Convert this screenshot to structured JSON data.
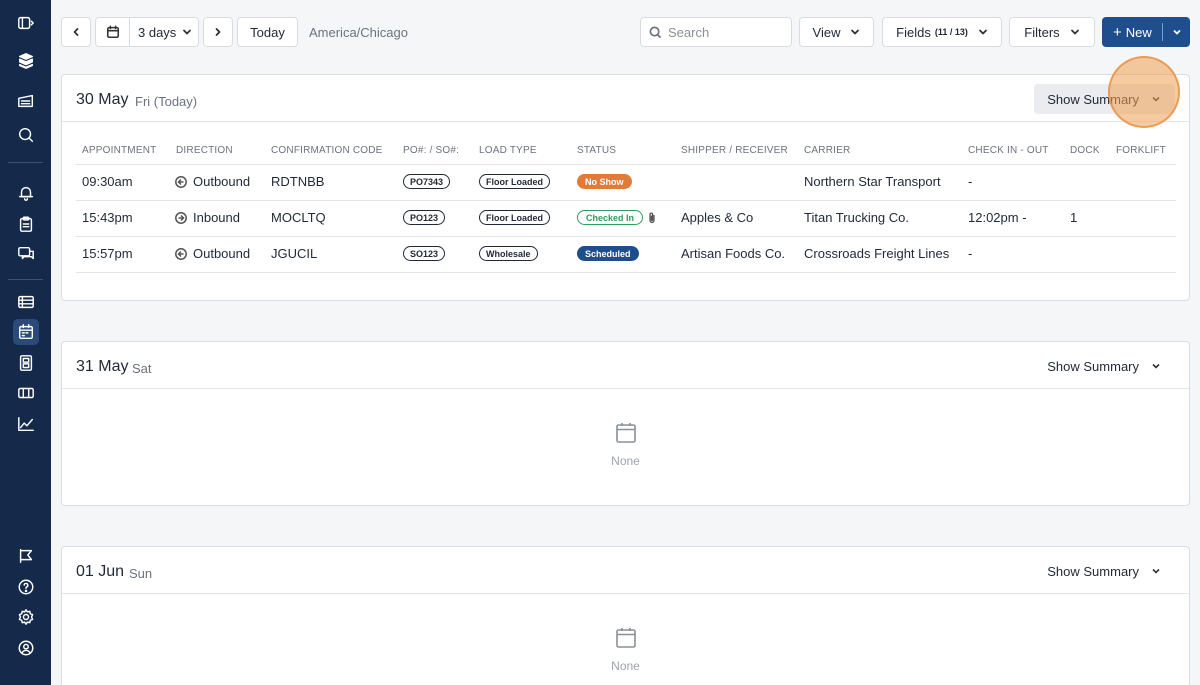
{
  "toolbar": {
    "range_label": "3 days",
    "today_label": "Today",
    "timezone": "America/Chicago",
    "search_placeholder": "Search",
    "view_label": "View",
    "fields_label": "Fields",
    "fields_count": "(11 / 13)",
    "filters_label": "Filters",
    "new_label": "New"
  },
  "days": [
    {
      "date": "30 May",
      "weekday": "Fri (Today)",
      "summary_label": "Show Summary"
    },
    {
      "date": "31 May",
      "weekday": "Sat",
      "summary_label": "Show Summary",
      "empty_label": "None"
    },
    {
      "date": "01 Jun",
      "weekday": "Sun",
      "summary_label": "Show Summary",
      "empty_label": "None"
    }
  ],
  "table": {
    "headers": [
      "APPOINTMENT",
      "DIRECTION",
      "CONFIRMATION CODE",
      "PO#: / SO#:",
      "LOAD TYPE",
      "STATUS",
      "SHIPPER / RECEIVER",
      "CARRIER",
      "CHECK IN - OUT",
      "DOCK",
      "FORKLIFT"
    ],
    "rows": [
      {
        "time": "09:30am",
        "direction": "Outbound",
        "code": "RDTNBB",
        "po": "PO7343",
        "load": "Floor Loaded",
        "status": "No Show",
        "shipper": "",
        "carrier": "Northern Star Transport",
        "check": "-",
        "dock": "",
        "forklift": ""
      },
      {
        "time": "15:43pm",
        "direction": "Inbound",
        "code": "MOCLTQ",
        "po": "PO123",
        "load": "Floor Loaded",
        "status": "Checked In",
        "shipper": "Apples & Co",
        "carrier": "Titan Trucking Co.",
        "check": "12:02pm -",
        "dock": "1",
        "forklift": ""
      },
      {
        "time": "15:57pm",
        "direction": "Outbound",
        "code": "JGUCIL",
        "po": "SO123",
        "load": "Wholesale",
        "status": "Scheduled",
        "shipper": "Artisan Foods Co.",
        "carrier": "Crossroads Freight Lines",
        "check": "-",
        "dock": "",
        "forklift": ""
      }
    ]
  },
  "colors": {
    "sidebar": "#152a4a",
    "primary": "#1f4e8c",
    "no_show": "#e07b39",
    "checked_in": "#2e9d5b"
  }
}
